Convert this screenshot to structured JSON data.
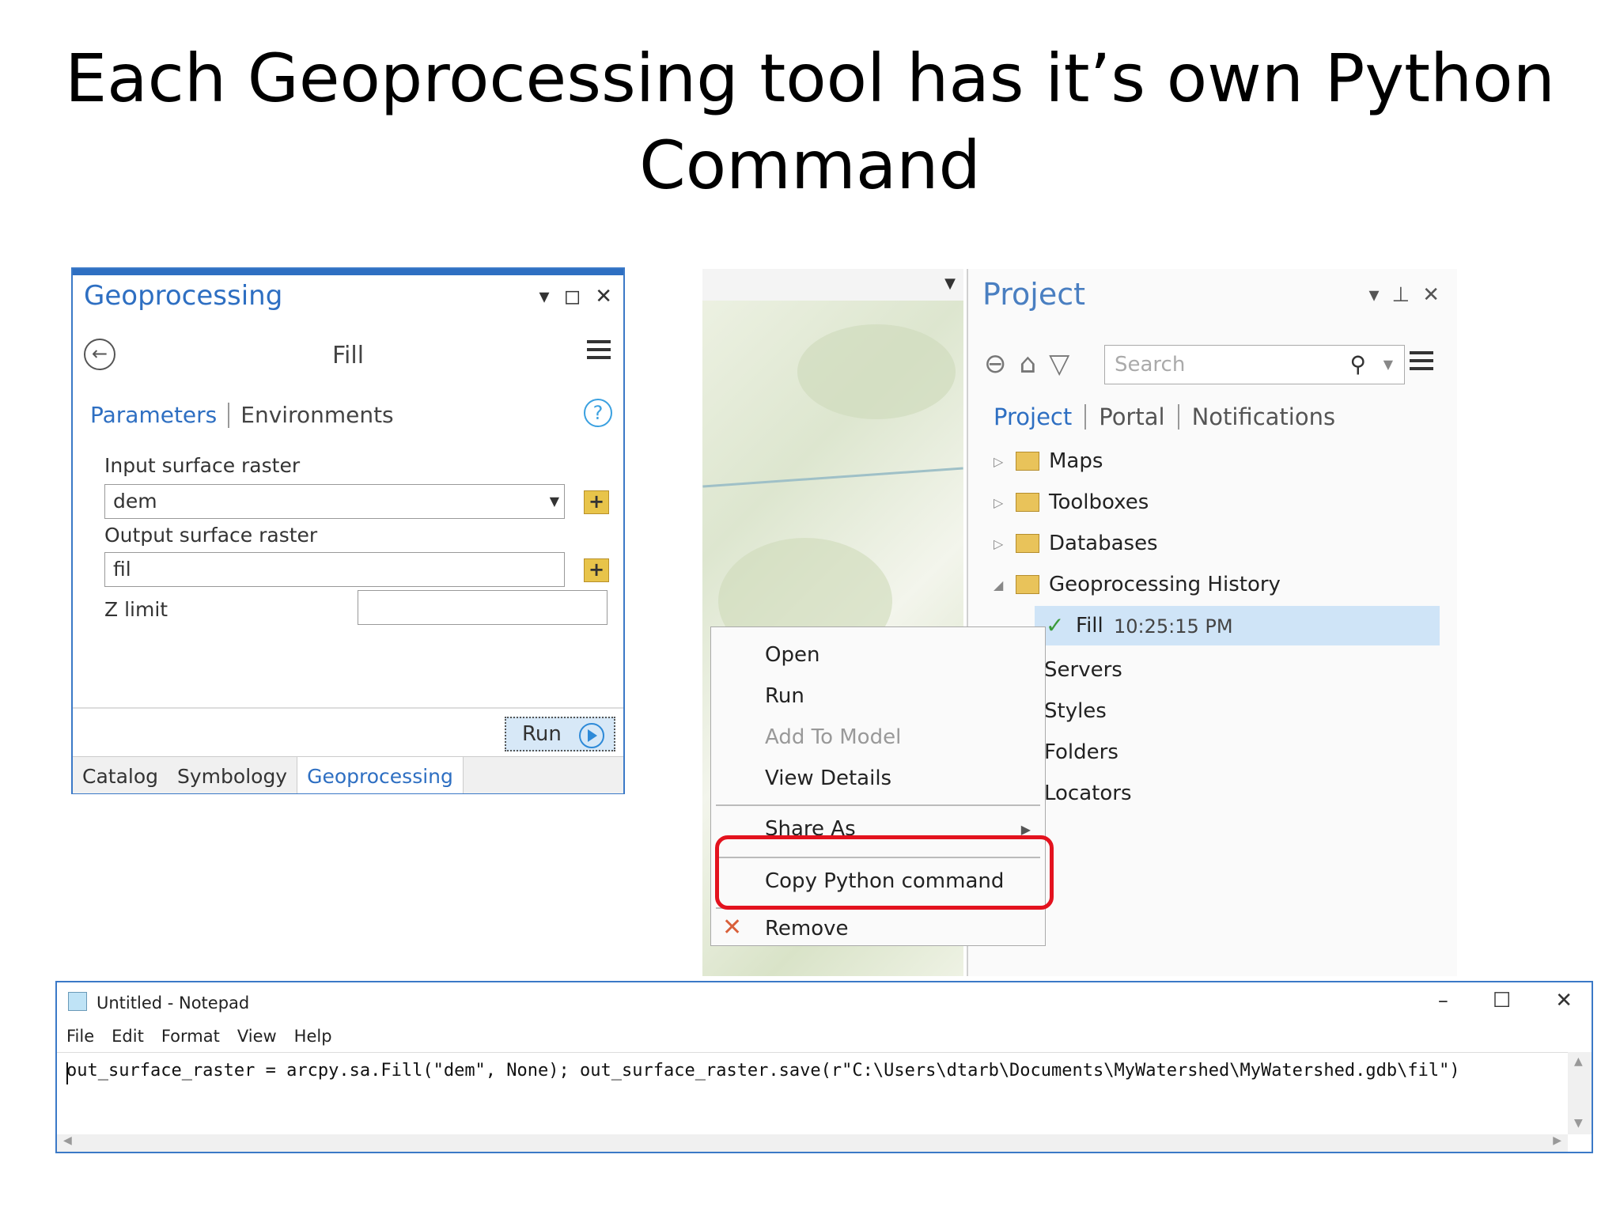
{
  "slide": {
    "title_line1": "Each Geoprocessing tool has it’s own Python",
    "title_line2": "Command"
  },
  "geoprocessing": {
    "pane_title": "Geoprocessing",
    "tool_name": "Fill",
    "tabs": {
      "parameters": "Parameters",
      "environments": "Environments"
    },
    "input_label": "Input surface raster",
    "input_value": "dem",
    "output_label": "Output surface raster",
    "output_value": "fil",
    "zlimit_label": "Z limit",
    "zlimit_value": "",
    "run_label": "Run",
    "bottom_tabs": [
      "Catalog",
      "Symbology",
      "Geoprocessing"
    ]
  },
  "project": {
    "pane_title": "Project",
    "search_placeholder": "Search",
    "tabs": [
      "Project",
      "Portal",
      "Notifications"
    ],
    "items": [
      "Maps",
      "Toolboxes",
      "Databases",
      "Geoprocessing History"
    ],
    "history_entry": {
      "name": "Fill",
      "time": "10:25:15 PM"
    },
    "partial_items": [
      "Servers",
      "Styles",
      "Folders",
      "Locators"
    ]
  },
  "context_menu": {
    "items": [
      "Open",
      "Run",
      "Add To Model",
      "View Details",
      "Share As",
      "Copy Python command",
      "Remove"
    ]
  },
  "notepad": {
    "title": "Untitled - Notepad",
    "menus": [
      "File",
      "Edit",
      "Format",
      "View",
      "Help"
    ],
    "content": "out_surface_raster = arcpy.sa.Fill(\"dem\", None); out_surface_raster.save(r\"C:\\Users\\dtarb\\Documents\\MyWatershed\\MyWatershed.gdb\\fil\")"
  },
  "colors": {
    "accent": "#2e6fc2",
    "highlight_red": "#e3121e",
    "selection": "#cfe4f7"
  }
}
